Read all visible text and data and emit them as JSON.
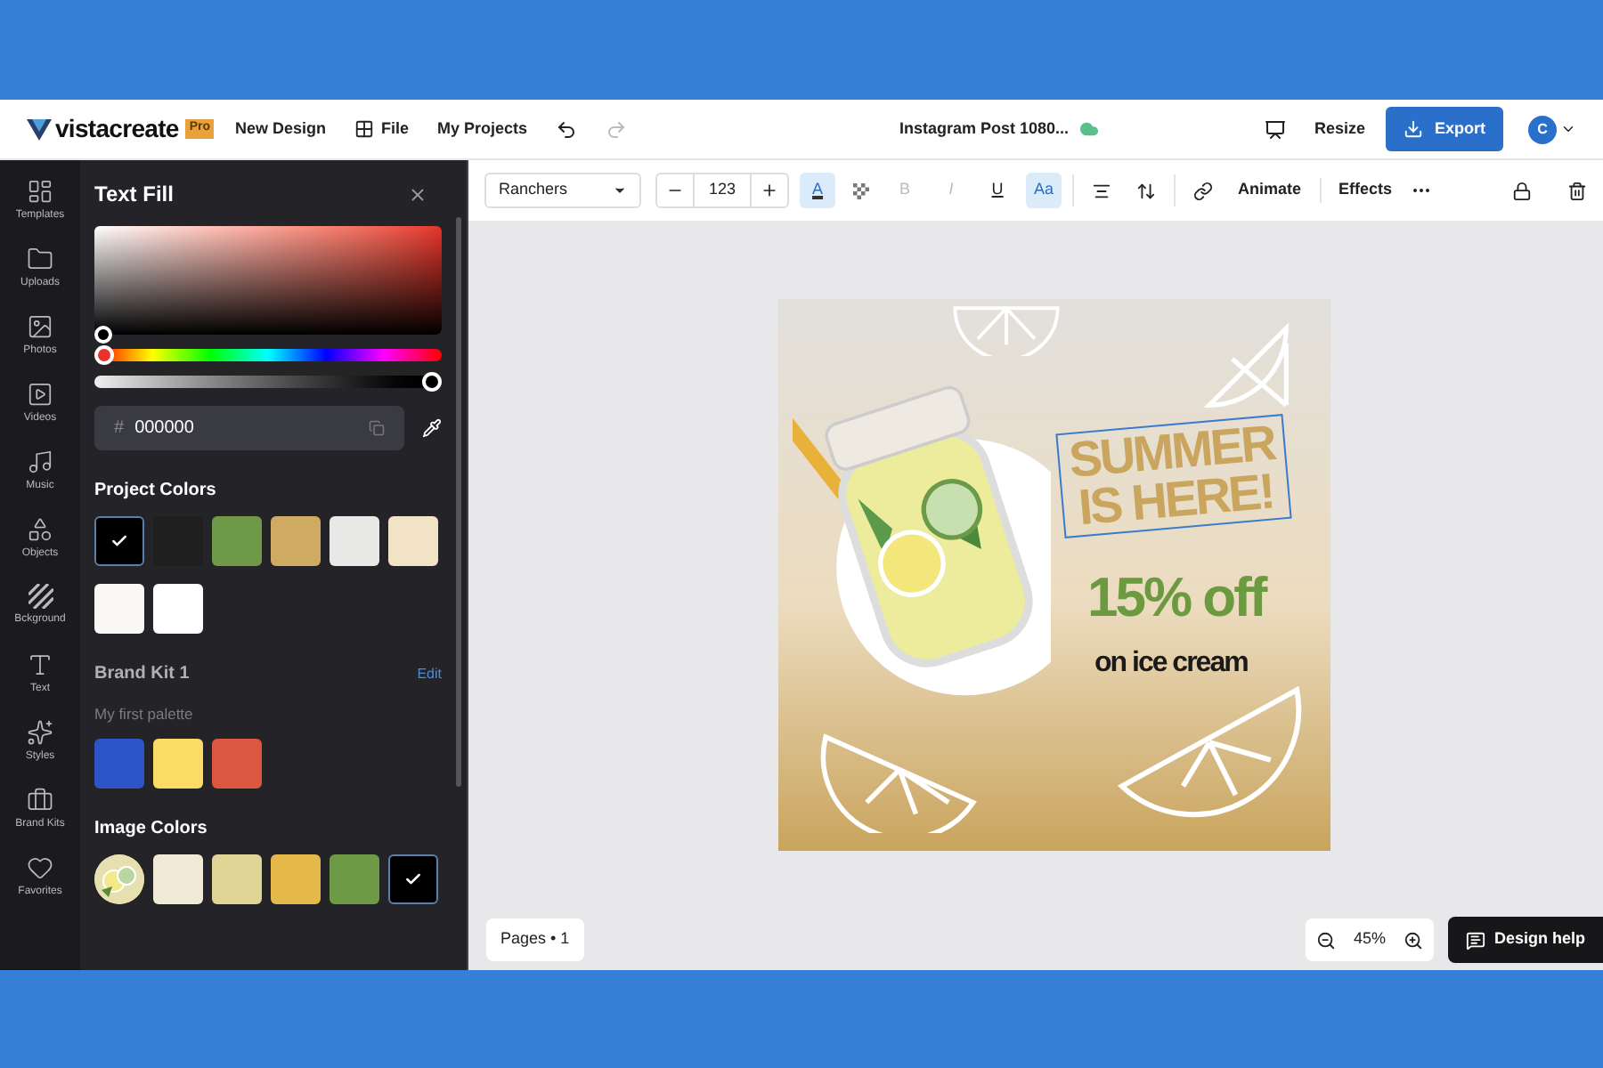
{
  "header": {
    "logo": "vistacreate",
    "plan_badge": "Pro",
    "menu": [
      {
        "label": "New Design",
        "kind": "text"
      },
      {
        "label": "File",
        "kind": "grid"
      },
      {
        "label": "My Projects",
        "kind": "text"
      }
    ],
    "title": "Instagram Post 1080...",
    "resize": "Resize",
    "export": "Export",
    "avatar": "C"
  },
  "rail": [
    {
      "label": "Templates"
    },
    {
      "label": "Uploads"
    },
    {
      "label": "Photos"
    },
    {
      "label": "Videos"
    },
    {
      "label": "Music"
    },
    {
      "label": "Objects"
    },
    {
      "label": "Bckground"
    },
    {
      "label": "Text"
    },
    {
      "label": "Styles"
    },
    {
      "label": "Brand Kits"
    },
    {
      "label": "Favorites"
    }
  ],
  "panel": {
    "title": "Text Fill",
    "hue": {
      "level": 0
    },
    "opacity": {
      "level": 1
    },
    "hex": {
      "prefix": "#",
      "value": "000000"
    },
    "project_colors": {
      "title": "Project Colors",
      "swatches": [
        {
          "color": "#000000",
          "selected": true
        },
        {
          "color": "#1e1e1e",
          "selected": false
        },
        {
          "color": "#6e9a48",
          "selected": false
        },
        {
          "color": "#cfaa62",
          "selected": false
        },
        {
          "color": "#e8e8e6",
          "selected": false
        },
        {
          "color": "#f2e2c6",
          "selected": false
        },
        {
          "color": "#faf8f5",
          "selected": false
        },
        {
          "color": "#ffffff",
          "selected": false
        }
      ]
    },
    "brand_kit": {
      "title": "Brand Kit 1",
      "edit": "Edit",
      "palette": "My first palette",
      "swatches": [
        {
          "color": "#2d55c8",
          "selected": false
        },
        {
          "color": "#fadb65",
          "selected": false
        },
        {
          "color": "#dc5640",
          "selected": false
        }
      ]
    },
    "image_colors": {
      "title": "Image Colors",
      "swatches": [
        {
          "kind": "image",
          "selected": false
        },
        {
          "kind": "color",
          "color": "#f0ead6",
          "selected": false
        },
        {
          "kind": "color",
          "color": "#e0d595",
          "selected": false
        },
        {
          "kind": "color",
          "color": "#e4b94a",
          "selected": false
        },
        {
          "kind": "color",
          "color": "#6f9a45",
          "selected": false
        },
        {
          "kind": "color",
          "color": "#000000",
          "selected": true
        }
      ]
    }
  },
  "toolbar": {
    "font": "Ranchers",
    "size": "123",
    "text_color": {
      "label": "A",
      "active": true
    },
    "format": [
      {
        "label": "B",
        "disabled": true,
        "active": false
      },
      {
        "label": "I",
        "disabled": true,
        "active": false
      },
      {
        "label": "U",
        "disabled": false,
        "active": false
      },
      {
        "label": "Aa",
        "disabled": false,
        "active": true
      }
    ],
    "actions": [
      "Animate",
      "Effects"
    ]
  },
  "design": {
    "headline": "SUMMER IS HERE!",
    "selected": true,
    "offer": "15% off",
    "subline": "on ice cream"
  },
  "footer": {
    "pages": "Pages • 1",
    "zoom": "45%",
    "help": "Design help"
  }
}
